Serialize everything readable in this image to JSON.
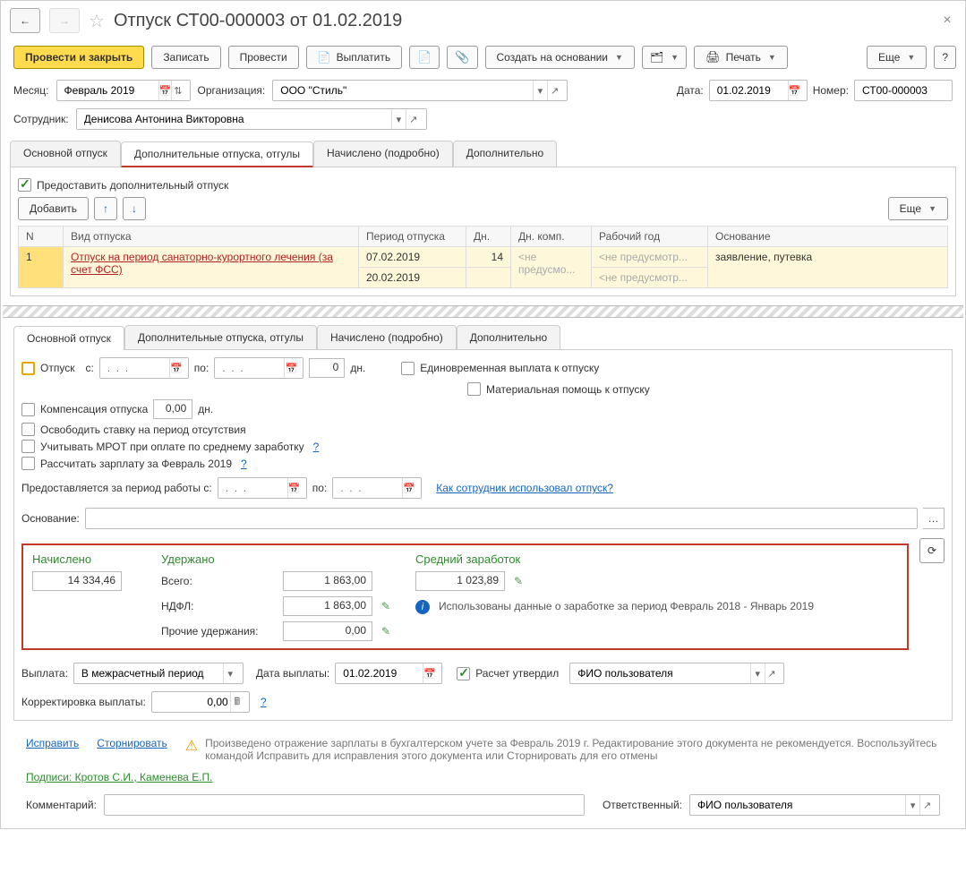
{
  "title": "Отпуск СТ00-000003 от 01.02.2019",
  "toolbar": {
    "post_close": "Провести и закрыть",
    "save": "Записать",
    "post": "Провести",
    "pay": "Выплатить",
    "create_based": "Создать на основании",
    "print": "Печать",
    "more": "Еще",
    "help": "?"
  },
  "header": {
    "month_label": "Месяц:",
    "month": "Февраль 2019",
    "org_label": "Организация:",
    "org": "ООО \"Стиль\"",
    "date_label": "Дата:",
    "date": "01.02.2019",
    "num_label": "Номер:",
    "num": "СТ00-000003",
    "emp_label": "Сотрудник:",
    "emp": "Денисова Антонина Викторовна"
  },
  "tabs1": {
    "main": "Основной отпуск",
    "additional": "Дополнительные отпуска, отгулы",
    "accrued": "Начислено (подробно)",
    "extra": "Дополнительно"
  },
  "t1": {
    "grant_label": "Предоставить дополнительный отпуск",
    "add": "Добавить",
    "more": "Еще",
    "cols": {
      "n": "N",
      "type": "Вид отпуска",
      "period": "Период отпуска",
      "days": "Дн.",
      "dayscomp": "Дн. комп.",
      "workyear": "Рабочий год",
      "basis": "Основание"
    },
    "row": {
      "n": "1",
      "type": "Отпуск на период санаторно-курортного лечения (за счет ФСС)",
      "from": "07.02.2019",
      "to": "20.02.2019",
      "days": "14",
      "comp": "<не предусмо...",
      "wy1": "<не предусмотр...",
      "wy2": "<не предусмотр...",
      "basis": "заявление, путевка"
    }
  },
  "tabs2": {
    "main": "Основной отпуск",
    "additional": "Дополнительные отпуска, отгулы",
    "accrued": "Начислено (подробно)",
    "extra": "Дополнительно"
  },
  "t2": {
    "vac_label": "Отпуск",
    "from_label": "с:",
    "to_label": "по:",
    "days_zero": "0",
    "days_unit": "дн.",
    "onetime": "Единовременная выплата к отпуску",
    "material": "Материальная помощь к отпуску",
    "comp_label": "Компенсация отпуска",
    "comp_val": "0,00",
    "comp_unit": "дн.",
    "free_rate": "Освободить ставку на период отсутствия",
    "mrot": "Учитывать МРОТ при оплате по среднему заработку",
    "calc_month": "Рассчитать зарплату за Февраль 2019",
    "q": "?",
    "period_label": "Предоставляется за период работы с:",
    "period_to": "по:",
    "howused": "Как сотрудник использовал отпуск?",
    "basis_label": "Основание:"
  },
  "calc": {
    "accrued_h": "Начислено",
    "withheld_h": "Удержано",
    "avg_h": "Средний заработок",
    "accrued": "14 334,46",
    "total_l": "Всего:",
    "total": "1 863,00",
    "ndfl_l": "НДФЛ:",
    "ndfl": "1 863,00",
    "other_l": "Прочие удержания:",
    "other": "0,00",
    "avg": "1 023,89",
    "info": "Использованы данные о заработке за период Февраль 2018 - Январь 2019"
  },
  "pay": {
    "label": "Выплата:",
    "mode": "В межрасчетный период",
    "date_l": "Дата выплаты:",
    "date": "01.02.2019",
    "approved": "Расчет утвердил",
    "fio": "ФИО пользователя",
    "corr_l": "Корректировка выплаты:",
    "corr": "0,00",
    "q": "?"
  },
  "footer": {
    "fix": "Исправить",
    "storno": "Сторнировать",
    "warn": "Произведено отражение зарплаты в бухгалтерском учете за Февраль 2019 г. Редактирование этого документа не рекомендуется. Воспользуйтесь командой Исправить для исправления этого документа или Сторнировать для его отмены",
    "sign": "Подписи: Кротов С.И., Каменева Е.П.",
    "comment_l": "Комментарий:",
    "resp_l": "Ответственный:",
    "resp": "ФИО пользователя"
  }
}
